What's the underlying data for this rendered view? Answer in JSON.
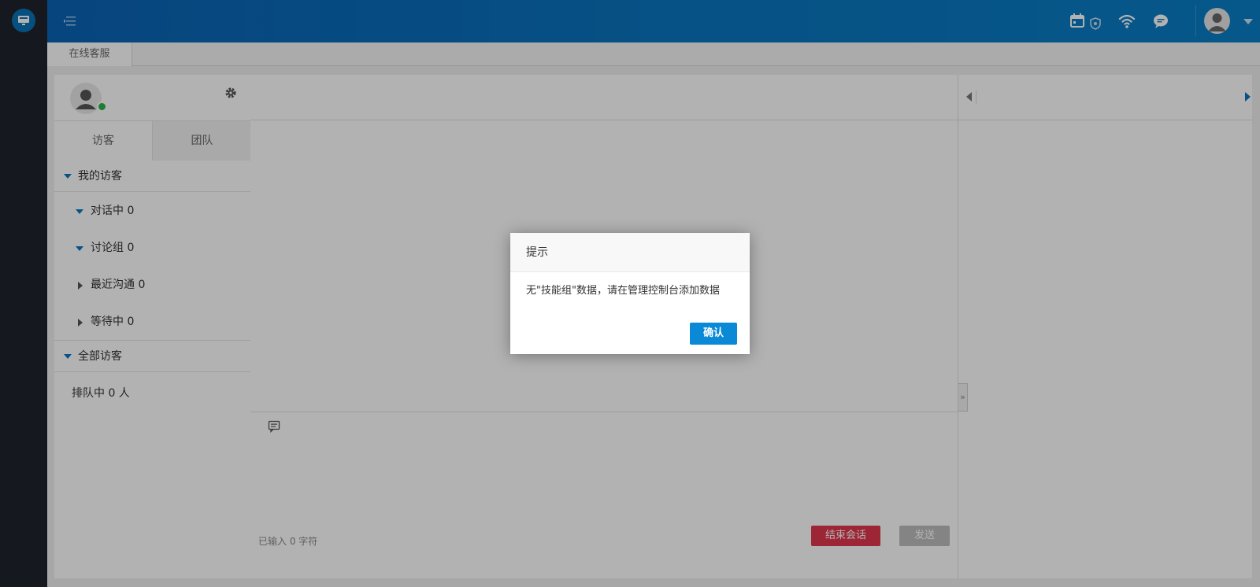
{
  "app": {
    "logo_icon": "monitor-icon"
  },
  "header": {
    "icons": [
      "calendar-icon",
      "shield-icon",
      "wifi-icon",
      "chat-bubble-icon"
    ],
    "avatar_icon": "user-icon"
  },
  "tabs": [
    {
      "label": "在线客服"
    }
  ],
  "left_panel": {
    "settings_icon": "gear-icon",
    "tabs": [
      {
        "label": "访客"
      },
      {
        "label": "团队"
      }
    ],
    "sections": {
      "my_visitors": {
        "label": "我的访客"
      },
      "in_chat": {
        "label": "对话中 0"
      },
      "discussion": {
        "label": "讨论组 0"
      },
      "recent": {
        "label": "最近沟通 0"
      },
      "waiting": {
        "label": "等待中 0"
      },
      "all_visitors": {
        "label": "全部访客"
      }
    },
    "queue_text": "排队中 0 人"
  },
  "chat": {
    "char_count": "已输入 0 字符",
    "end_button": "结束会话",
    "send_button": "发送"
  },
  "dialog": {
    "title": "提示",
    "message": "无\"技能组\"数据，请在管理控制台添加数据",
    "confirm": "确认"
  },
  "colors": {
    "header_blue": "#0a74bf",
    "accent": "#0a89d6",
    "danger": "#e0374c",
    "online": "#29b44a"
  }
}
